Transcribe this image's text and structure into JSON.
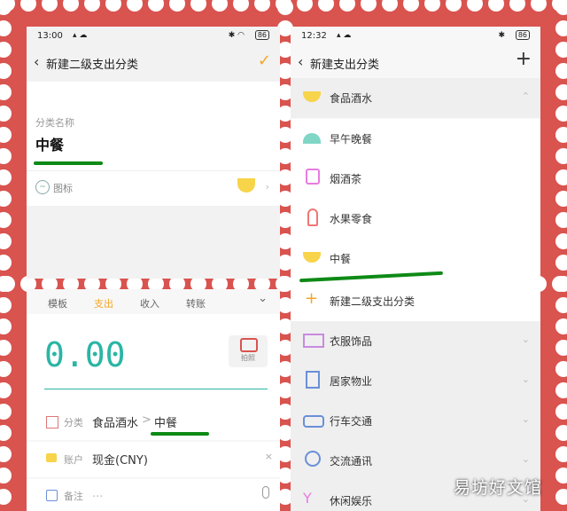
{
  "left_top": {
    "status": {
      "time": "13:00",
      "battery": "86"
    },
    "title": "新建二级支出分类",
    "field_label": "分类名称",
    "field_value": "中餐",
    "icon_label": "图标"
  },
  "left_bottom": {
    "tabs": [
      "模板",
      "支出",
      "收入",
      "转账",
      "",
      "⌄"
    ],
    "active_tab_index": 1,
    "amount": "0.00",
    "camera_label": "拍照",
    "category_label": "分类",
    "category_parent": "食品酒水",
    "category_sep": ">",
    "category_child": "中餐",
    "account_label": "账户",
    "account_value": "现金(CNY)",
    "note_label": "备注",
    "note_value": "..."
  },
  "right": {
    "status": {
      "time": "12:32",
      "battery": "86"
    },
    "title": "新建支出分类",
    "plus": "+",
    "group_name": "食品酒水",
    "sub_items": [
      {
        "label": "早午晚餐",
        "icon": "dish-icon"
      },
      {
        "label": "烟酒茶",
        "icon": "bag-icon"
      },
      {
        "label": "水果零食",
        "icon": "popsicle-icon"
      },
      {
        "label": "中餐",
        "icon": "bowl-icon"
      }
    ],
    "add_sub_label": "新建二级支出分类",
    "categories": [
      {
        "label": "衣服饰品",
        "icon": "clothes-icon"
      },
      {
        "label": "居家物业",
        "icon": "home-icon"
      },
      {
        "label": "行车交通",
        "icon": "car-icon"
      },
      {
        "label": "交流通讯",
        "icon": "phone-icon"
      },
      {
        "label": "休闲娱乐",
        "icon": "cocktail-icon"
      }
    ]
  },
  "watermark": "易坊好文馆",
  "colors": {
    "frame": "#d9534f",
    "accent": "#f5a623",
    "teal": "#2bb5a5",
    "underline": "#0e8a16"
  }
}
